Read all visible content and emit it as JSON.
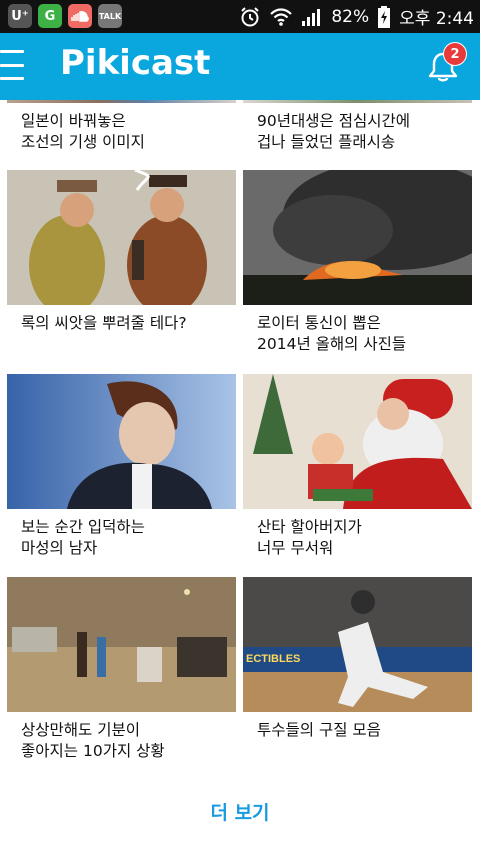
{
  "status_bar": {
    "apps": [
      {
        "name": "u-plus-app-icon",
        "text": "U⁺",
        "color": "#555555"
      },
      {
        "name": "g-app-icon",
        "text": "G",
        "color": "#3db146"
      },
      {
        "name": "soundcloud-app-icon",
        "text": "",
        "color": "#ef6b63"
      },
      {
        "name": "kakaotalk-app-icon",
        "text": "TALK",
        "color": "#777777"
      }
    ],
    "battery_percent": "82%",
    "time": "오후 2:44"
  },
  "app_bar": {
    "logo": "Pikicast",
    "notification_count": "2"
  },
  "feed": {
    "cards": [
      {
        "id": "c0",
        "caption_line1": "일본이 바꿔놓은",
        "caption_line2": "조선의 기생 이미지"
      },
      {
        "id": "c1",
        "caption_line1": "90년대생은 점심시간에",
        "caption_line2": "겁나 들었던 플래시송"
      },
      {
        "id": "c2",
        "caption_line1": "록의 씨앗을 뿌려줄 테다?",
        "caption_line2": ""
      },
      {
        "id": "c3",
        "caption_line1": "로이터 통신이 뽑은",
        "caption_line2": "2014년 올해의 사진들"
      },
      {
        "id": "c4",
        "caption_line1": "보는 순간 입덕하는",
        "caption_line2": "마성의 남자"
      },
      {
        "id": "c5",
        "caption_line1": "산타 할아버지가",
        "caption_line2": "너무 무서워"
      },
      {
        "id": "c6",
        "caption_line1": "상상만해도 기분이",
        "caption_line2": "좋아지는 10가지 상황"
      },
      {
        "id": "c7",
        "caption_line1": "투수들의 구질 모음",
        "caption_line2": ""
      }
    ],
    "more_label": "더 보기"
  }
}
